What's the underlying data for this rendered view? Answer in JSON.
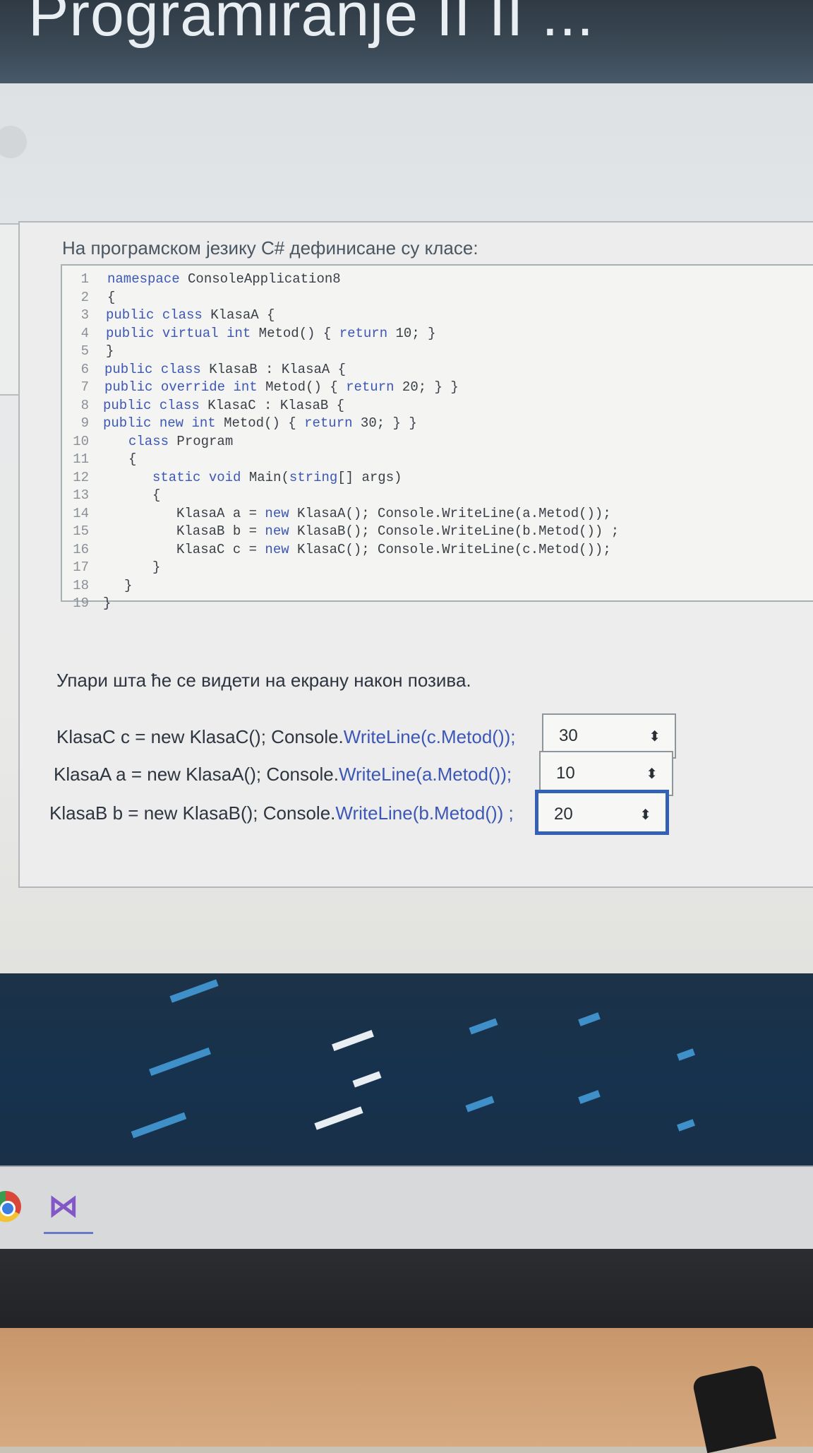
{
  "window": {
    "title": "Programiranje II II ..."
  },
  "question": {
    "intro": "На програмском језику C# дефинисане су класе:",
    "code_lines": [
      {
        "n": "1",
        "text": "namespace ConsoleApplication8",
        "indent": 6
      },
      {
        "n": "2",
        "text": "{",
        "indent": 6
      },
      {
        "n": "3",
        "text": "public class KlasaA {",
        "indent": 4
      },
      {
        "n": "4",
        "text": "public virtual int Metod() { return 10; }",
        "indent": 4
      },
      {
        "n": "5",
        "text": "}",
        "indent": 4
      },
      {
        "n": "6",
        "text": "public class KlasaB : KlasaA {",
        "indent": 2
      },
      {
        "n": "7",
        "text": "public override int Metod() { return 20; } }",
        "indent": 2
      },
      {
        "n": "8",
        "text": "public class KlasaC : KlasaB {",
        "indent": 0
      },
      {
        "n": "9",
        "text": "public new int Metod() { return 30; } }",
        "indent": 0
      },
      {
        "n": "10",
        "text": "class Program",
        "indent": 36
      },
      {
        "n": "11",
        "text": "{",
        "indent": 36
      },
      {
        "n": "12",
        "text": "static void Main(string[] args)",
        "indent": 70
      },
      {
        "n": "13",
        "text": "{",
        "indent": 70
      },
      {
        "n": "14",
        "text": "KlasaA a = new KlasaA(); Console.WriteLine(a.Metod());",
        "indent": 104
      },
      {
        "n": "15",
        "text": "KlasaB b = new KlasaB(); Console.WriteLine(b.Metod()) ;",
        "indent": 104
      },
      {
        "n": "16",
        "text": "KlasaC c = new KlasaC(); Console.WriteLine(c.Metod());",
        "indent": 104
      },
      {
        "n": "17",
        "text": "}",
        "indent": 70
      },
      {
        "n": "18",
        "text": "}",
        "indent": 30
      },
      {
        "n": "19",
        "text": "}",
        "indent": 0
      }
    ],
    "instruction": "Упари шта ће се видети на екрану након позива.",
    "matches": [
      {
        "pre": "KlasaC c = new KlasaC(); Console.",
        "method": "WriteLine(c.Metod());",
        "value": "30"
      },
      {
        "pre": "KlasaA a = new KlasaA(); Console.",
        "method": "WriteLine(a.Metod());",
        "value": "10"
      },
      {
        "pre": "KlasaB b = new KlasaB(); Console.",
        "method": "WriteLine(b.Metod()) ;",
        "value": "20"
      }
    ]
  },
  "taskbar": {
    "icons": [
      "chrome-icon",
      "visual-studio-icon"
    ]
  },
  "colors": {
    "keyword": "#3d57b5",
    "focus": "#3561b5",
    "header": "#2f3a44"
  }
}
